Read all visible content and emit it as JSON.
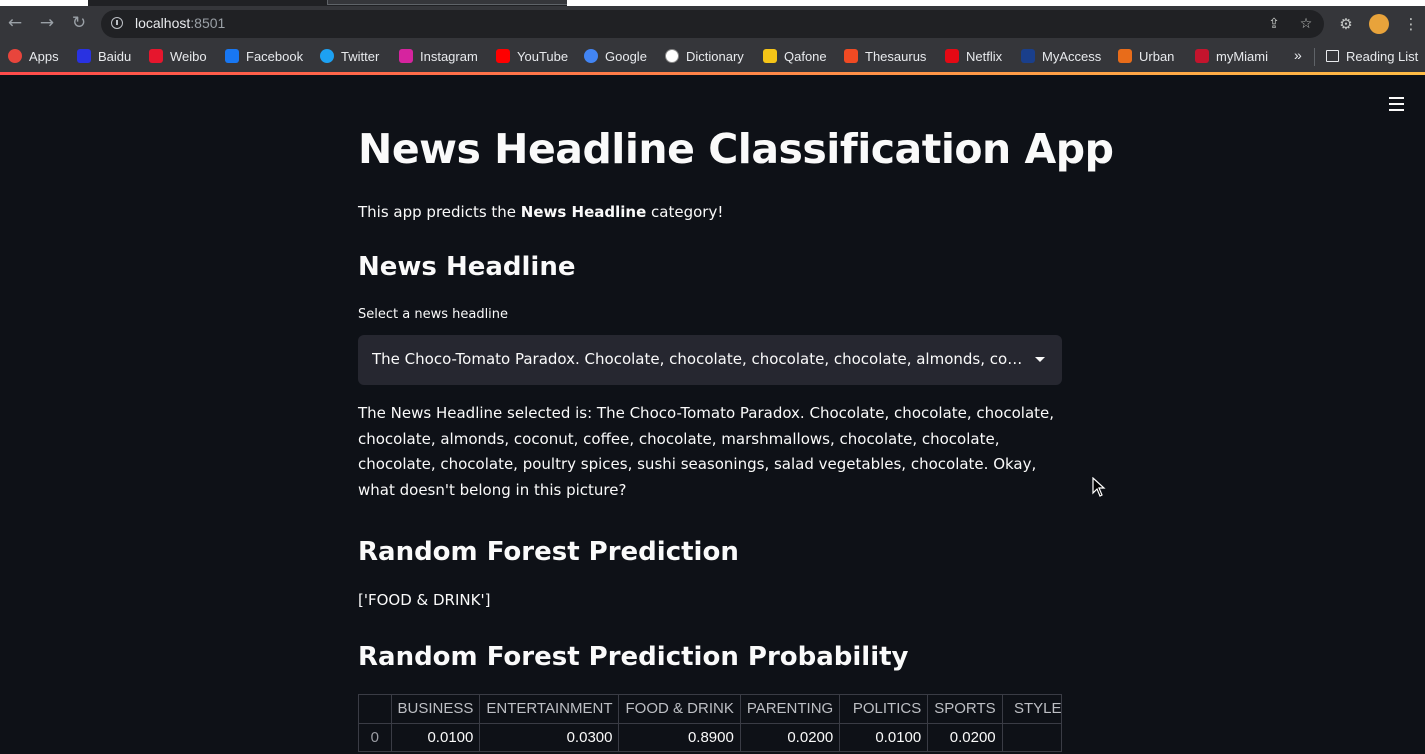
{
  "browser": {
    "url_host": "localhost",
    "url_port": ":8501",
    "bookmarks": [
      {
        "label": "Apps",
        "icon": "apps-grid-icon",
        "color": "#e8453c"
      },
      {
        "label": "Baidu",
        "icon": "baidu-icon",
        "color": "#2932e1"
      },
      {
        "label": "Weibo",
        "icon": "weibo-icon",
        "color": "#e6162d"
      },
      {
        "label": "Facebook",
        "icon": "facebook-icon",
        "color": "#1877f2"
      },
      {
        "label": "Twitter",
        "icon": "twitter-icon",
        "color": "#1da1f2"
      },
      {
        "label": "Instagram",
        "icon": "instagram-icon",
        "color": "#d6249f"
      },
      {
        "label": "YouTube",
        "icon": "youtube-icon",
        "color": "#ff0000"
      },
      {
        "label": "Google",
        "icon": "google-icon",
        "color": "#4285f4"
      },
      {
        "label": "Dictionary",
        "icon": "dictionary-icon",
        "color": "#ffffff"
      },
      {
        "label": "Qafone",
        "icon": "qafone-icon",
        "color": "#f5c518"
      },
      {
        "label": "Thesaurus",
        "icon": "thesaurus-icon",
        "color": "#f04a23"
      },
      {
        "label": "Netflix",
        "icon": "netflix-icon",
        "color": "#e50914"
      },
      {
        "label": "MyAccess",
        "icon": "myaccess-icon",
        "color": "#1a3f8b"
      },
      {
        "label": "Urban",
        "icon": "urban-icon",
        "color": "#e86c1a"
      },
      {
        "label": "myMiami",
        "icon": "mymiami-icon",
        "color": "#c3142d"
      }
    ],
    "more_label": "»",
    "reading_list_label": "Reading List"
  },
  "app": {
    "title": "News Headline Classification App",
    "desc_prefix": "This app predicts the ",
    "desc_bold": "News Headline",
    "desc_suffix": " category!",
    "section_headline": "News Headline",
    "select_label": "Select a news headline",
    "select_value": "The Choco-Tomato Paradox. Chocolate, chocolate, chocolate, chocolate, almonds, coconut, coffee, chocolate, marshmallows, chocolate, chocolate, chocolate, chocolate, poultry spices, sushi seasonings, salad vegetables, chocolate. Okay, what doesn't belong in this picture?",
    "selected_text": "The News Headline selected is: The Choco-Tomato Paradox. Chocolate, chocolate, chocolate, chocolate, almonds, coconut, coffee, chocolate, marshmallows, chocolate, chocolate, chocolate, chocolate, poultry spices, sushi seasonings, salad vegetables, chocolate. Okay, what doesn't belong in this picture?",
    "section_prediction": "Random Forest Prediction",
    "prediction": "['FOOD & DRINK']",
    "section_probability": "Random Forest Prediction Probability",
    "table": {
      "columns": [
        "",
        "BUSINESS",
        "ENTERTAINMENT",
        "FOOD & DRINK",
        "PARENTING",
        "POLITICS",
        "SPORTS",
        "STYLE &"
      ],
      "rows": [
        [
          "0",
          "0.0100",
          "0.0300",
          "0.8900",
          "0.0200",
          "0.0100",
          "0.0200",
          ""
        ]
      ]
    }
  },
  "colors": {
    "background": "#0e1117",
    "select_bg": "#262730",
    "accent_gradient_start": "#ff4b4b",
    "accent_gradient_end": "#ffbd45"
  }
}
